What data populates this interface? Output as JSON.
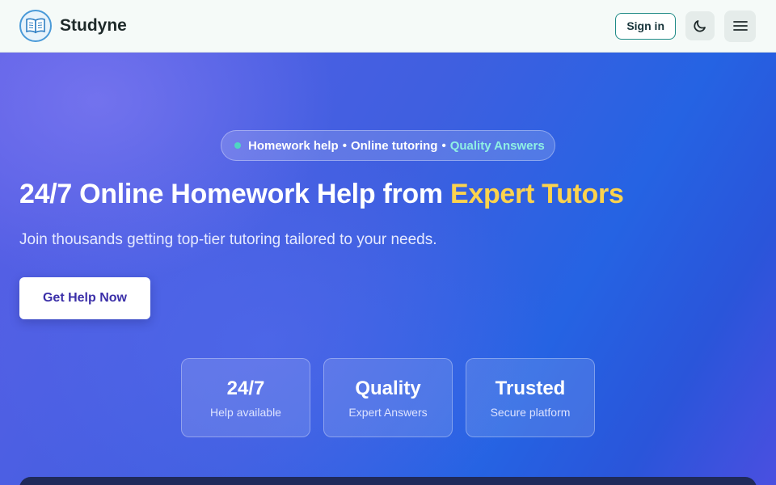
{
  "header": {
    "brand_name": "Studyne",
    "logo_icon": "open-book-icon",
    "signin_label": "Sign in",
    "theme_icon": "moon-icon",
    "menu_icon": "hamburger-menu-icon"
  },
  "hero": {
    "pill": {
      "part1": "Homework help",
      "separator": "•",
      "part2": "Online tutoring",
      "part3": "Quality Answers"
    },
    "headline": {
      "main": "24/7 Online Homework Help from ",
      "accent": "Expert Tutors"
    },
    "subtitle": "Join thousands getting top-tier tutoring tailored to your needs.",
    "cta_label": "Get Help Now",
    "stats": [
      {
        "value": "24/7",
        "label": "Help available"
      },
      {
        "value": "Quality",
        "label": "Expert Answers"
      },
      {
        "value": "Trusted",
        "label": "Secure platform"
      }
    ]
  },
  "colors": {
    "accent_yellow": "#fcd34d",
    "accent_teal": "#8ff0e4",
    "cta_text": "#3b2fa8",
    "header_bg": "#f5faf8"
  }
}
